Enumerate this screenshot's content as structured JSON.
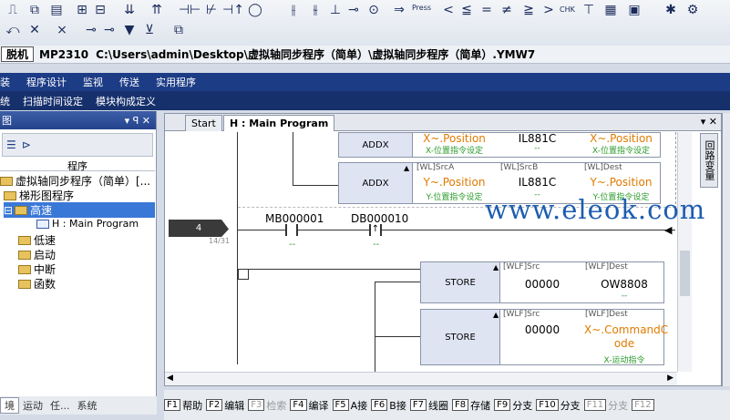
{
  "toolbar": {
    "press_label": "Press",
    "chk_label": "CHK"
  },
  "path": {
    "status": "脱机",
    "model": "MP2310",
    "file_path": "C:\\Users\\admin\\Desktop\\虚拟轴同步程序（简单）\\虚拟轴同步程序（简单）.YMW7"
  },
  "menu": {
    "items": [
      "装",
      "程序设计",
      "监视",
      "传送",
      "实用程序"
    ]
  },
  "submenu": {
    "items": [
      "统",
      "扫描时间设定",
      "模块构成定义"
    ]
  },
  "left_panel": {
    "title": "图",
    "column_header": "程序",
    "tree": [
      "虚拟轴同步程序（简单）[...",
      "梯形图程序",
      "高速",
      "H : Main Program",
      "低速",
      "启动",
      "中断",
      "函数"
    ]
  },
  "editor": {
    "tabs": [
      "Start",
      "H : Main Program"
    ],
    "rung_number": "4",
    "rung_step": "14/31",
    "contact1": "MB000001",
    "contact1_val": "--",
    "contact2": "DB000010",
    "contact2_val": "--",
    "blocks": [
      {
        "name": "ADDX",
        "src_a_label": "",
        "src_a": "X~.Position",
        "src_a_sub": "X-位置指令设定",
        "src_b_label": "",
        "src_b": "IL881C",
        "src_b_sub": "--",
        "dest_label": "",
        "dest": "X~.Position",
        "dest_sub": "X-位置指令设定"
      },
      {
        "name": "ADDX",
        "src_a_label": "[WL]SrcA",
        "src_a": "Y~.Position",
        "src_a_sub": "Y-位置指令设定",
        "src_b_label": "[WL]SrcB",
        "src_b": "IL881C",
        "src_b_sub": "--",
        "dest_label": "[WL]Dest",
        "dest": "Y~.Position",
        "dest_sub": "Y-位置指令设定"
      },
      {
        "name": "STORE",
        "src_label": "[WLF]Src",
        "src": "00000",
        "dest_label": "[WLF]Dest",
        "dest": "OW8808",
        "dest_sub": "--"
      },
      {
        "name": "STORE",
        "src_label": "[WLF]Src",
        "src": "00000",
        "dest_label": "[WLF]Dest",
        "dest": "X~.CommandC ode",
        "dest_sub": "X-运动指令"
      }
    ]
  },
  "right_panel": {
    "label": "回路变量"
  },
  "fkeys": [
    {
      "key": "F1",
      "label": "帮助"
    },
    {
      "key": "F2",
      "label": "编辑"
    },
    {
      "key": "F3",
      "label": "检索"
    },
    {
      "key": "F4",
      "label": "编译"
    },
    {
      "key": "F5",
      "label": "A接"
    },
    {
      "key": "F6",
      "label": "B接"
    },
    {
      "key": "F7",
      "label": "线圈"
    },
    {
      "key": "F8",
      "label": "存储"
    },
    {
      "key": "F9",
      "label": "分支"
    },
    {
      "key": "F10",
      "label": "分支"
    },
    {
      "key": "F11",
      "label": "分支"
    },
    {
      "key": "F12",
      "label": ""
    }
  ],
  "bottom_tabs": [
    "境",
    "运动",
    "任...",
    "系统"
  ],
  "watermark": "www.eleok.com"
}
